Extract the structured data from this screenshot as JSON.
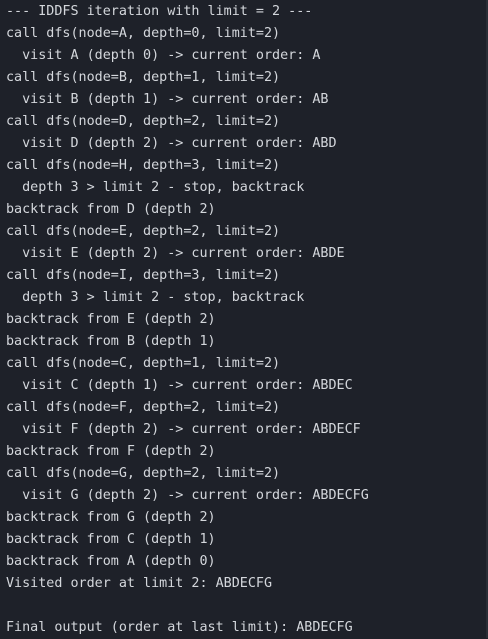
{
  "terminal": {
    "lines": [
      "--- IDDFS iteration with limit = 2 ---",
      "call dfs(node=A, depth=0, limit=2)",
      "  visit A (depth 0) -> current order: A",
      "call dfs(node=B, depth=1, limit=2)",
      "  visit B (depth 1) -> current order: AB",
      "call dfs(node=D, depth=2, limit=2)",
      "  visit D (depth 2) -> current order: ABD",
      "call dfs(node=H, depth=3, limit=2)",
      "  depth 3 > limit 2 - stop, backtrack",
      "backtrack from D (depth 2)",
      "call dfs(node=E, depth=2, limit=2)",
      "  visit E (depth 2) -> current order: ABDE",
      "call dfs(node=I, depth=3, limit=2)",
      "  depth 3 > limit 2 - stop, backtrack",
      "backtrack from E (depth 2)",
      "backtrack from B (depth 1)",
      "call dfs(node=C, depth=1, limit=2)",
      "  visit C (depth 1) -> current order: ABDEC",
      "call dfs(node=F, depth=2, limit=2)",
      "  visit F (depth 2) -> current order: ABDECF",
      "backtrack from F (depth 2)",
      "call dfs(node=G, depth=2, limit=2)",
      "  visit G (depth 2) -> current order: ABDECFG",
      "backtrack from G (depth 2)",
      "backtrack from C (depth 1)",
      "backtrack from A (depth 0)",
      "Visited order at limit 2: ABDECFG",
      "",
      "Final output (order at last limit): ABDECFG"
    ]
  }
}
